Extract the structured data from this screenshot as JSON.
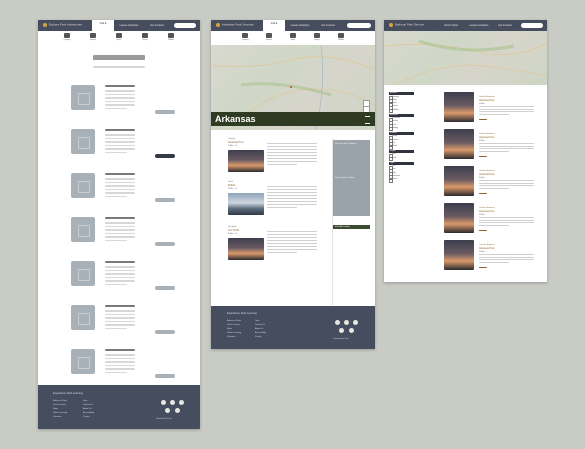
{
  "brand": "Explore Park Adventures",
  "nav": {
    "brand_middle": "Arkansas Park Services",
    "brand_right": "National Park Service",
    "items": [
      "Visit &",
      "Leisure & Explore",
      "Get Involved"
    ],
    "items_active_sub": "Visit & Travel"
  },
  "icons": [
    {
      "name": "tent-icon",
      "label": "Camping"
    },
    {
      "name": "compass-icon",
      "label": "Explore"
    },
    {
      "name": "map-icon",
      "label": "Maps"
    },
    {
      "name": "hiking-icon",
      "label": "Hiking"
    },
    {
      "name": "binoculars-icon",
      "label": "Wildlife"
    }
  ],
  "state": {
    "title": "Arkansas"
  },
  "articles": [
    {
      "kicker": "Ouachita",
      "title": "Arkansas Post",
      "sub": "5 Miles · 2h"
    },
    {
      "kicker": "Ozark",
      "title": "Buffalo",
      "sub": "4 Miles · 1h"
    },
    {
      "kicker": "Fort Smith",
      "title": "Fort Smith",
      "sub": "6 Miles · 3h"
    }
  ],
  "sidebar": {
    "title": "You Can Go Outdoors",
    "subtitle": "Stay Curious Today",
    "button": "Show All Locations"
  },
  "filters": {
    "groups": [
      {
        "title": "Activities",
        "items": [
          "Camping",
          "Hiking",
          "Biking",
          "Fishing",
          "Paddling"
        ]
      },
      {
        "title": "Amenities",
        "items": [
          "Restrooms",
          "Parking",
          "Picnic",
          "Lodging"
        ]
      },
      {
        "title": "Seasons",
        "items": [
          "Spring",
          "Summer",
          "Fall",
          "Winter"
        ]
      },
      {
        "title": "Region",
        "items": [
          "North",
          "South"
        ]
      },
      {
        "title": "Type",
        "items": [
          "Trail",
          "Park",
          "Lake",
          "Monument",
          "Forest"
        ]
      }
    ]
  },
  "list_right": [
    {
      "kicker": "Ouachita, Arkansas",
      "title": "Arkansas Post",
      "meta": "5 Miles"
    },
    {
      "kicker": "Ouachita, Arkansas",
      "title": "Arkansas Post",
      "meta": "5 Miles"
    },
    {
      "kicker": "Ouachita, Arkansas",
      "title": "Arkansas Post",
      "meta": "5 Miles"
    },
    {
      "kicker": "Ouachita, Arkansas",
      "title": "Arkansas Post",
      "meta": "5 Miles"
    },
    {
      "kicker": "Ouachita, Arkansas",
      "title": "Arkansas Post",
      "meta": "5 Miles"
    }
  ],
  "footer": {
    "title": "Experience Park Learning",
    "title_middle": "Experience Park Learning",
    "col1": [
      "Arkansas Parks",
      "Visitor Centers",
      "Maps",
      "Online Learning",
      "Volunteer"
    ],
    "col2": [
      "Jobs",
      "Contact Us",
      "About Us",
      "Accessibility",
      "Privacy"
    ],
    "credit": "Powered by the Parks"
  },
  "colors": {
    "nav": "#454d5e",
    "state_bar": "#2f3a22",
    "accent": "#d5a542",
    "placeholder": "#a9b1b8"
  }
}
